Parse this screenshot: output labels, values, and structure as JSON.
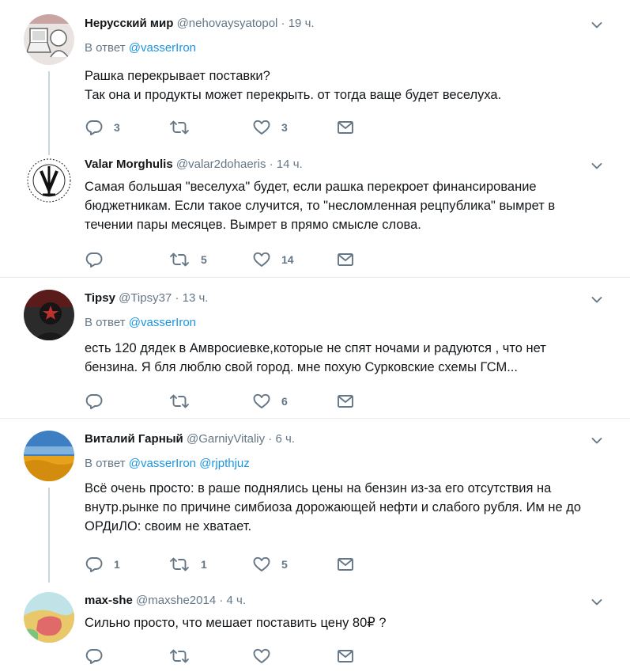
{
  "colors": {
    "link": "#1b95e0",
    "muted": "#657786",
    "text": "#14171a",
    "divider": "#e6ecf0",
    "thread_line": "#ccd6dd"
  },
  "icons": {
    "reply": "reply-icon",
    "retweet": "retweet-icon",
    "like": "heart-icon",
    "dm": "envelope-icon",
    "menu": "chevron-down-icon"
  },
  "tweets": [
    {
      "name": "Нерусский мир",
      "handle": "@nehovaysyatopol",
      "sep": "·",
      "time": "19 ч.",
      "reply_prefix": "В ответ",
      "reply_to": [
        "@vasserIron"
      ],
      "text": "Рашка перекрывает поставки?\nТак она и продукты может перекрыть. от тогда ваще будет веселуха.",
      "replies": "3",
      "retweets": "",
      "likes": "3"
    },
    {
      "name": "Valar Morghulis",
      "handle": "@valar2dohaeris",
      "sep": "·",
      "time": "14 ч.",
      "reply_prefix": "",
      "reply_to": [],
      "text": "Самая большая \"веселуха\" будет, если рашка перекроет финансирование бюджетникам. Если такое случится, то \"несломленная рецпублика\" вымрет в течении пары месяцев. Вымрет в прямо смысле слова.",
      "replies": "",
      "retweets": "5",
      "likes": "14"
    },
    {
      "name": "Tipsy",
      "handle": "@Tipsy37",
      "sep": "·",
      "time": "13 ч.",
      "reply_prefix": "В ответ",
      "reply_to": [
        "@vasserIron"
      ],
      "text": "есть 120 дядек в Амвросиевке,которые не спят ночами и радуются , что нет бензина. Я бля люблю свой город.  мне похую Сурковские схемы ГСМ...",
      "replies": "",
      "retweets": "",
      "likes": "6"
    },
    {
      "name": "Виталий Гарный",
      "handle": "@GarniyVitaliy",
      "sep": "·",
      "time": "6 ч.",
      "reply_prefix": "В ответ",
      "reply_to": [
        "@vasserIron",
        "@rjpthjuz"
      ],
      "text": "Всё очень просто: в раше поднялись цены на бензин из-за его отсутствия на внутр.рынке по причине симбиоза дорожающей нефти и слабого рубля. Им не до ОРДиЛО: своим не хватает.",
      "replies": "1",
      "retweets": "1",
      "likes": "5"
    },
    {
      "name": "max-she",
      "handle": "@maxshe2014",
      "sep": "·",
      "time": "4 ч.",
      "reply_prefix": "",
      "reply_to": [],
      "text": "Сильно просто, что мешает поставить цену 80₽ ?",
      "replies": "",
      "retweets": "",
      "likes": ""
    }
  ]
}
